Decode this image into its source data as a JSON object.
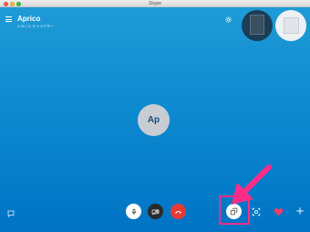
{
  "window": {
    "title": "Skype"
  },
  "call": {
    "contact_name": "Aprico",
    "status": "0:05 | 11 キャラクター",
    "avatar_initials": "Ap"
  },
  "icons": {
    "menu": "hamburger-menu-icon",
    "settings": "gear-icon",
    "chat": "chat-bubble-icon",
    "mic": "microphone-icon",
    "video_off": "video-off-icon",
    "hangup": "phone-hangup-icon",
    "switch_screens": "switch-screens-icon",
    "screenshot": "camera-snapshot-icon",
    "reaction": "heart-icon",
    "add": "plus-icon"
  },
  "colors": {
    "stage_top": "#1f9bd6",
    "stage_bottom": "#0073c4",
    "hangup": "#e53a35",
    "highlight": "#ff2d88",
    "heart": "#ff3b5c"
  }
}
